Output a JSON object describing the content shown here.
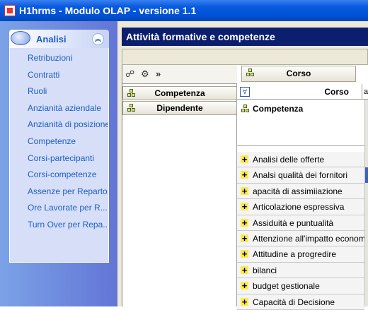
{
  "window": {
    "title": "H1hrms - Modulo OLAP - versione 1.1"
  },
  "sidebar": {
    "panel_title": "Analisi",
    "collapse_glyph": "︽",
    "items": [
      {
        "label": "Retribuzioni"
      },
      {
        "label": "Contratti"
      },
      {
        "label": "Ruoli"
      },
      {
        "label": "Anzianità aziendale"
      },
      {
        "label": "Anzianità di posizione"
      },
      {
        "label": "Competenze"
      },
      {
        "label": "Corsi-partecipanti"
      },
      {
        "label": "Corsi-competenze"
      },
      {
        "label": "Assenze per Reparto"
      },
      {
        "label": "Ore Lavorate per R..."
      },
      {
        "label": "Turn Over per Repa..."
      }
    ]
  },
  "main": {
    "title": "Attività formative e competenze",
    "toolbar_glyph": "»",
    "row_dimensions": [
      "Competenza",
      "Dipendente"
    ],
    "column_dimension": "Corso",
    "grid": {
      "column_header": "Corso",
      "partial_col": "a",
      "row_field": "Competenza",
      "rows": [
        "Analisi delle offerte",
        "Analsi qualità dei fornitori",
        "apacità di assimiiazione",
        "Articolazione espressiva",
        "Assiduità e puntualità",
        "Attenzione all'impatto economic",
        "Attitudine a progredire",
        "bilanci",
        "budget gestionale",
        "Capacità di Decisione"
      ]
    }
  },
  "colors": {
    "titlebar": "#0052d6",
    "olap_title_bg": "#0b1f6e",
    "link": "#215dc6",
    "sidebar": "#6f8fe0"
  }
}
